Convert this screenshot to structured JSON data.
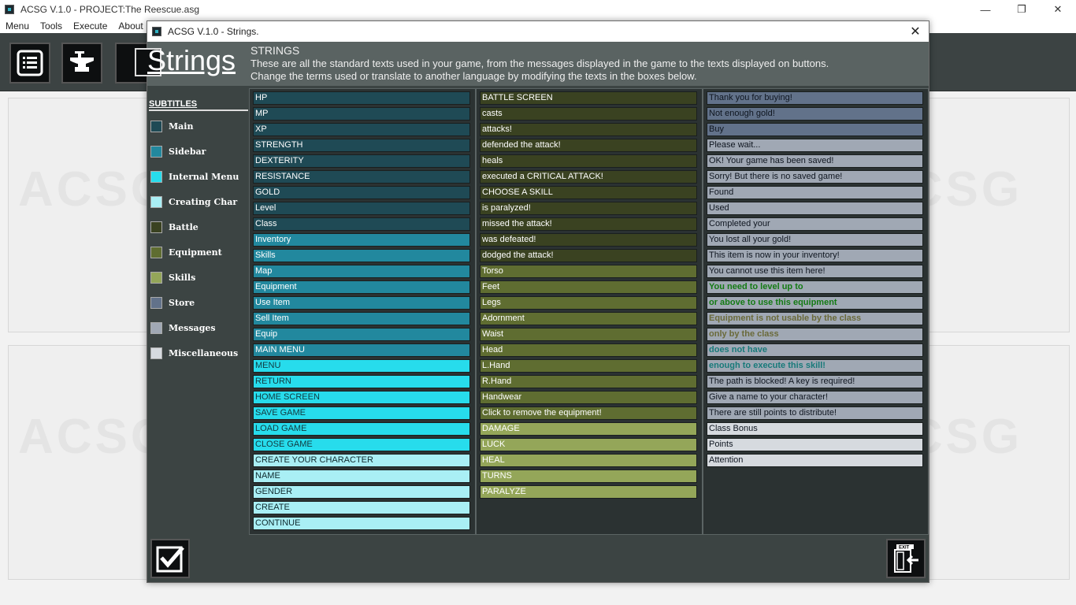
{
  "main_window": {
    "title": "ACSG V.1.0 - PROJECT:The Reescue.asg",
    "minimize": "—",
    "maximize": "❐",
    "close": "✕",
    "menu": [
      "Menu",
      "Tools",
      "Execute",
      "About"
    ]
  },
  "workspace": {
    "ghost_text": "ACSG"
  },
  "dialog": {
    "title": "ACSG V.1.0 - Strings.",
    "close": "✕",
    "header": {
      "title": "Strings",
      "heading": "STRINGS",
      "desc1": "These are all the standard texts used in your game, from the messages displayed in the game to the texts displayed on buttons.",
      "desc2": "Change the terms used or translate to another language by modifying the texts in the boxes below."
    },
    "sidebar": {
      "title": "SUBTITLES",
      "items": [
        {
          "label": "Main",
          "color": "#1f4a55"
        },
        {
          "label": "Sidebar",
          "color": "#22889e"
        },
        {
          "label": "Internal Menu",
          "color": "#27dcec"
        },
        {
          "label": "Creating Char",
          "color": "#a9eff5"
        },
        {
          "label": "Battle",
          "color": "#3a4221"
        },
        {
          "label": "Equipment",
          "color": "#5f6d31"
        },
        {
          "label": "Skills",
          "color": "#94a659"
        },
        {
          "label": "Store",
          "color": "#62728a"
        },
        {
          "label": "Messages",
          "color": "#a0a8b4"
        },
        {
          "label": "Miscellaneous",
          "color": "#d6dadf"
        }
      ]
    },
    "columns": [
      [
        {
          "text": "HP",
          "cat": 0
        },
        {
          "text": "MP",
          "cat": 0
        },
        {
          "text": "XP",
          "cat": 0
        },
        {
          "text": "STRENGTH",
          "cat": 0
        },
        {
          "text": "DEXTERITY",
          "cat": 0
        },
        {
          "text": "RESISTANCE",
          "cat": 0
        },
        {
          "text": "GOLD",
          "cat": 0
        },
        {
          "text": "Level",
          "cat": 0
        },
        {
          "text": "Class",
          "cat": 0
        },
        {
          "text": "Inventory",
          "cat": 1
        },
        {
          "text": "Skills",
          "cat": 1
        },
        {
          "text": "Map",
          "cat": 1
        },
        {
          "text": "Equipment",
          "cat": 1
        },
        {
          "text": "Use Item",
          "cat": 1
        },
        {
          "text": "Sell Item",
          "cat": 1
        },
        {
          "text": "Equip",
          "cat": 1
        },
        {
          "text": "MAIN MENU",
          "cat": 1
        },
        {
          "text": "MENU",
          "cat": 2
        },
        {
          "text": "RETURN",
          "cat": 2
        },
        {
          "text": "HOME SCREEN",
          "cat": 2
        },
        {
          "text": "SAVE GAME",
          "cat": 2
        },
        {
          "text": "LOAD GAME",
          "cat": 2
        },
        {
          "text": "CLOSE GAME",
          "cat": 2
        },
        {
          "text": "CREATE YOUR CHARACTER",
          "cat": 3
        },
        {
          "text": "NAME",
          "cat": 3
        },
        {
          "text": "GENDER",
          "cat": 3
        },
        {
          "text": "CREATE",
          "cat": 3
        },
        {
          "text": "CONTINUE",
          "cat": 3
        }
      ],
      [
        {
          "text": "BATTLE SCREEN",
          "cat": 4
        },
        {
          "text": "casts",
          "cat": 4
        },
        {
          "text": "attacks!",
          "cat": 4
        },
        {
          "text": "defended the attack!",
          "cat": 4
        },
        {
          "text": "heals",
          "cat": 4
        },
        {
          "text": "executed a CRITICAL ATTACK!",
          "cat": 4
        },
        {
          "text": "CHOOSE A SKILL",
          "cat": 4
        },
        {
          "text": "is paralyzed!",
          "cat": 4
        },
        {
          "text": "missed the attack!",
          "cat": 4
        },
        {
          "text": "was defeated!",
          "cat": 4
        },
        {
          "text": "dodged the attack!",
          "cat": 4
        },
        {
          "text": "Torso",
          "cat": 5
        },
        {
          "text": "Feet",
          "cat": 5
        },
        {
          "text": "Legs",
          "cat": 5
        },
        {
          "text": "Adornment",
          "cat": 5
        },
        {
          "text": "Waist",
          "cat": 5
        },
        {
          "text": "Head",
          "cat": 5
        },
        {
          "text": "L.Hand",
          "cat": 5
        },
        {
          "text": "R.Hand",
          "cat": 5
        },
        {
          "text": "Handwear",
          "cat": 5
        },
        {
          "text": "Click to remove the equipment!",
          "cat": 5
        },
        {
          "text": "DAMAGE",
          "cat": 6
        },
        {
          "text": "LUCK",
          "cat": 6
        },
        {
          "text": "HEAL",
          "cat": 6
        },
        {
          "text": "TURNS",
          "cat": 6
        },
        {
          "text": "PARALYZE",
          "cat": 6
        }
      ],
      [
        {
          "text": "Thank you for buying!",
          "cat": 7
        },
        {
          "text": "Not enough gold!",
          "cat": 7
        },
        {
          "text": "Buy",
          "cat": 7
        },
        {
          "text": "Please wait...",
          "cat": 8
        },
        {
          "text": "OK! Your game has been saved!",
          "cat": 8
        },
        {
          "text": "Sorry! But there is no saved game!",
          "cat": 8
        },
        {
          "text": "Found",
          "cat": 8
        },
        {
          "text": "Used",
          "cat": 8
        },
        {
          "text": "Completed your",
          "cat": 8
        },
        {
          "text": "You lost all your gold!",
          "cat": 8
        },
        {
          "text": "This item is now in your inventory!",
          "cat": 8
        },
        {
          "text": "You cannot use this item here!",
          "cat": 8
        },
        {
          "text": "You need to level up to",
          "cat": 8,
          "bold": true,
          "color": "#137a13"
        },
        {
          "text": "or above to use this equipment",
          "cat": 8,
          "bold": true,
          "color": "#137a13"
        },
        {
          "text": "Equipment is not usable by the class",
          "cat": 8,
          "bold": true,
          "color": "#6a6a3a"
        },
        {
          "text": "only by the class",
          "cat": 8,
          "bold": true,
          "color": "#6a6a3a"
        },
        {
          "text": "does not have",
          "cat": 8,
          "bold": true,
          "color": "#187a7a"
        },
        {
          "text": "enough to execute this skill!",
          "cat": 8,
          "bold": true,
          "color": "#187a7a"
        },
        {
          "text": "The path is blocked! A key is required!",
          "cat": 8
        },
        {
          "text": "Give a name to your character!",
          "cat": 8
        },
        {
          "text": "There are still points to distribute!",
          "cat": 8
        },
        {
          "text": "Class Bonus",
          "cat": 9
        },
        {
          "text": "Points",
          "cat": 9
        },
        {
          "text": "Attention",
          "cat": 9
        }
      ]
    ],
    "text_colors": [
      "#ffffff",
      "#ffffff",
      "#123a40",
      "#0f2a2e",
      "#ffffff",
      "#ffffff",
      "#ffffff",
      "#0f1620",
      "#0f1620",
      "#0f1620"
    ],
    "footer": {
      "ok_icon": "checkmark-icon",
      "exit_icon": "exit-door-icon",
      "exit_label": "EXIT"
    }
  }
}
